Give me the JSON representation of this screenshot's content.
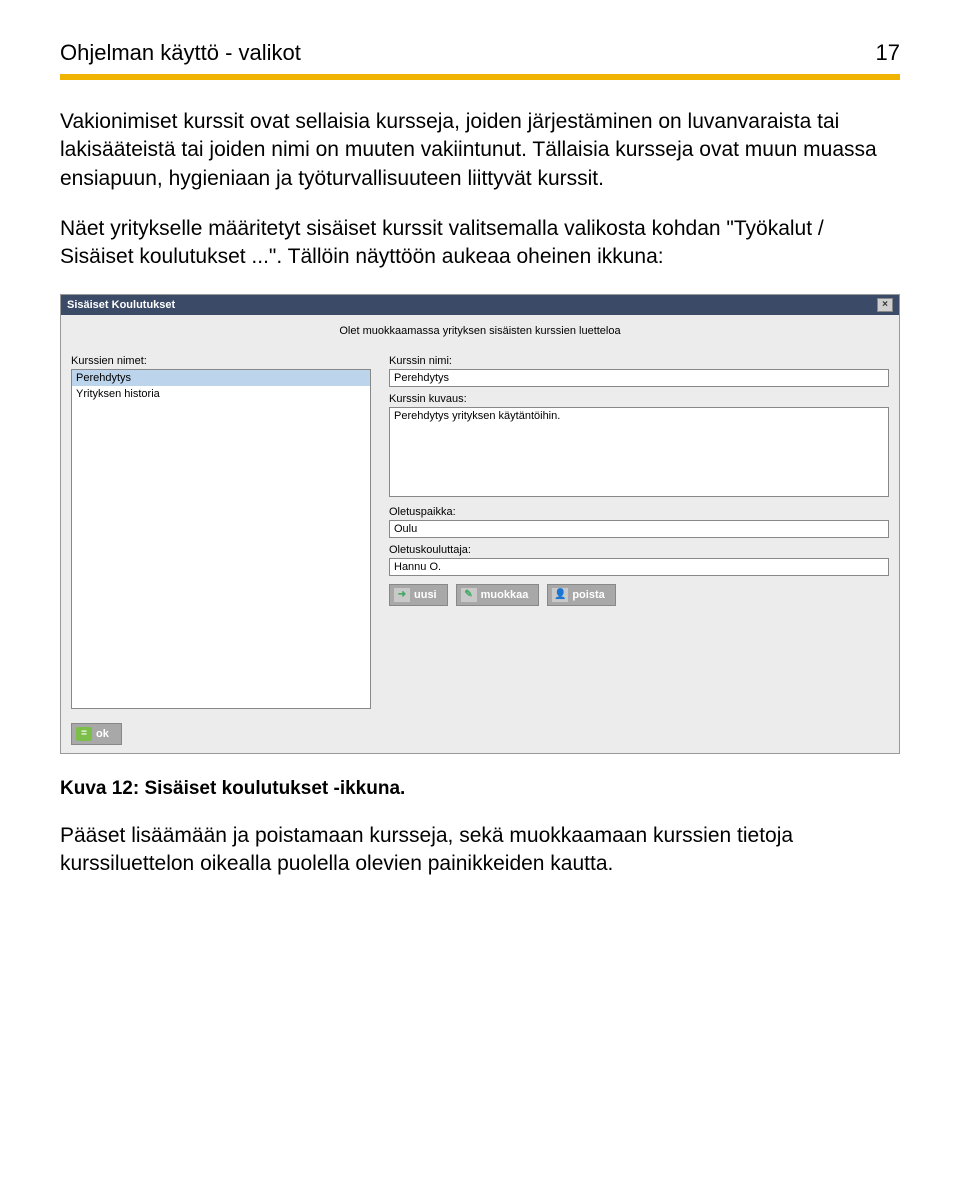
{
  "header": {
    "title": "Ohjelman käyttö -   valikot",
    "page_number": "17"
  },
  "paragraphs": {
    "p1": "Vakionimiset kurssit ovat sellaisia kursseja, joiden järjestäminen on luvanvaraista tai lakisääteistä tai joiden nimi on muuten vakiintunut. Tällaisia kursseja ovat muun muassa ensiapuun, hygieniaan ja työturvallisuuteen liittyvät kurssit.",
    "p2": "Näet yritykselle määritetyt sisäiset kurssit valitsemalla valikosta kohdan \"Työkalut / Sisäiset koulutukset ...\". Tällöin näyttöön aukeaa oheinen ikkuna:",
    "p3": "Pääset lisäämään ja poistamaan kursseja, sekä muokkaamaan kurssien tietoja kurssiluettelon oikealla puolella olevien painikkeiden kautta."
  },
  "caption": "Kuva 12: Sisäiset koulutukset -ikkuna.",
  "dialog": {
    "title": "Sisäiset Koulutukset",
    "subtitle": "Olet muokkaamassa yrityksen sisäisten kurssien luetteloa",
    "left": {
      "label": "Kurssien nimet:",
      "items": [
        "Perehdytys",
        "Yrityksen historia"
      ]
    },
    "right": {
      "name_label": "Kurssin nimi:",
      "name_value": "Perehdytys",
      "desc_label": "Kurssin kuvaus:",
      "desc_value": "Perehdytys yrityksen käytäntöihin.",
      "place_label": "Oletuspaikka:",
      "place_value": "Oulu",
      "trainer_label": "Oletuskouluttaja:",
      "trainer_value": "Hannu O."
    },
    "buttons": {
      "new": "uusi",
      "edit": "muokkaa",
      "delete": "poista",
      "ok": "ok"
    }
  }
}
